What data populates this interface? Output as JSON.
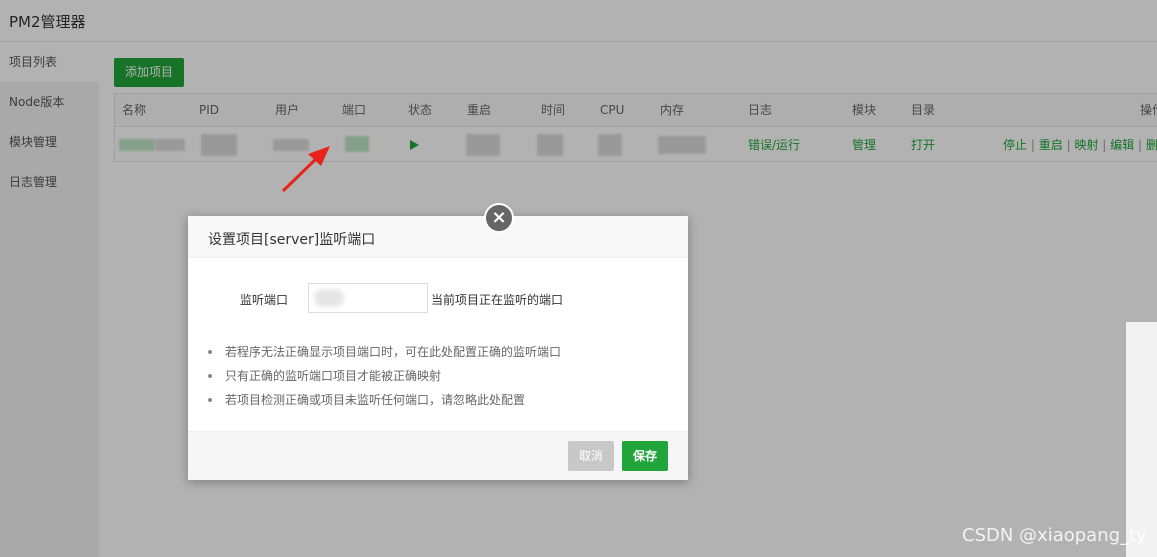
{
  "app": {
    "title": "PM2管理器"
  },
  "sidebar": {
    "items": [
      {
        "label": "项目列表"
      },
      {
        "label": "Node版本"
      },
      {
        "label": "模块管理"
      },
      {
        "label": "日志管理"
      }
    ]
  },
  "toolbar": {
    "add_label": "添加项目"
  },
  "table": {
    "columns": [
      "名称",
      "PID",
      "用户",
      "端口",
      "状态",
      "重启",
      "时间",
      "CPU",
      "内存",
      "日志",
      "模块",
      "目录",
      "操作"
    ],
    "row": {
      "log_link": "错误/运行",
      "module_link": "管理",
      "dir_link": "打开",
      "actions": [
        "停止",
        "重启",
        "映射",
        "编辑",
        "删除"
      ],
      "separator": "|"
    }
  },
  "modal": {
    "title": "设置项目[server]监听端口",
    "field_label": "监听端口",
    "field_value": "",
    "field_hint": "当前项目正在监听的端口",
    "tips": [
      "若程序无法正确显示项目端口时，可在此处配置正确的监听端口",
      "只有正确的监听端口项目才能被正确映射",
      "若项目检测正确或项目未监听任何端口，请忽略此处配置"
    ],
    "cancel_label": "取消",
    "save_label": "保存",
    "close_symbol": "×"
  },
  "watermark": {
    "text": "CSDN @xiaopang_ty"
  },
  "colors": {
    "accent": "#20a53a",
    "cancel": "#c8c8c8"
  }
}
